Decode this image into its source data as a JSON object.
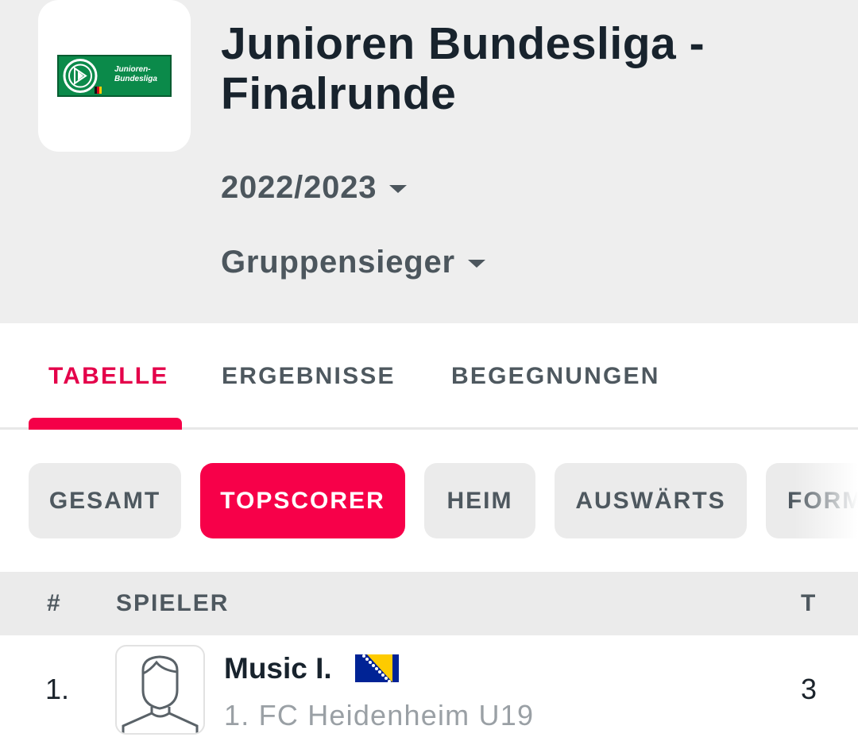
{
  "header": {
    "title": "Junioren Bundesliga - Finalrunde",
    "logo_text_line1": "Junioren-",
    "logo_text_line2": "Bundesliga",
    "season": "2022/2023",
    "round": "Gruppensieger"
  },
  "tabs": [
    {
      "label": "TABELLE",
      "active": true
    },
    {
      "label": "ERGEBNISSE",
      "active": false
    },
    {
      "label": "BEGEGNUNGEN",
      "active": false
    }
  ],
  "filters": [
    {
      "label": "GESAMT",
      "active": false
    },
    {
      "label": "TOPSCORER",
      "active": true
    },
    {
      "label": "HEIM",
      "active": false
    },
    {
      "label": "AUSWÄRTS",
      "active": false
    },
    {
      "label": "FORM",
      "active": false
    }
  ],
  "table": {
    "columns": {
      "rank": "#",
      "player": "SPIELER",
      "goals": "T"
    },
    "rows": [
      {
        "rank": "1.",
        "player": "Music I.",
        "nationality_icon": "bosnia-herzegovina-flag-icon",
        "team": "1. FC Heidenheim U19",
        "goals": "3"
      }
    ]
  },
  "colors": {
    "accent": "#f70049",
    "header_bg": "#eeeeee",
    "chip_bg": "#ebebeb",
    "text_dark": "#18232d",
    "text_muted": "#4e585f"
  }
}
